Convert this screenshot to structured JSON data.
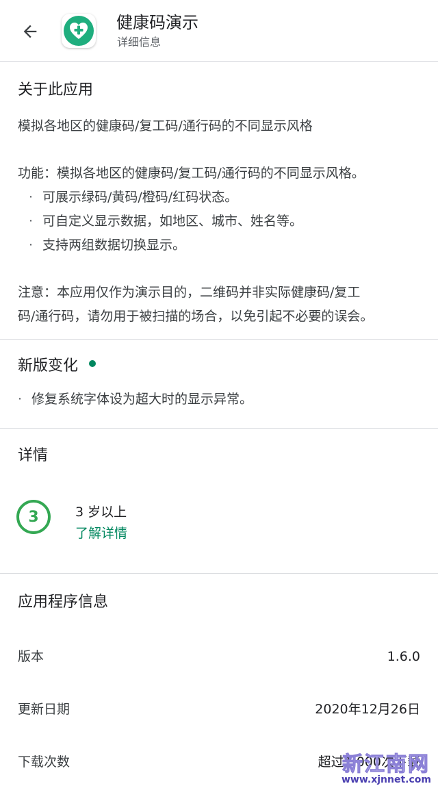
{
  "header": {
    "back_icon": "arrow-back-icon",
    "app_icon": "health-shield-plus-icon",
    "title": "健康码演示",
    "subtitle": "详细信息"
  },
  "about": {
    "title": "关于此应用",
    "summary": "模拟各地区的健康码/复工码/通行码的不同显示风格",
    "features_intro": "功能：模拟各地区的健康码/复工码/通行码的不同显示风格。",
    "bullets": [
      "可展示绿码/黄码/橙码/红码状态。",
      "可自定义显示数据，如地区、城市、姓名等。",
      "支持两组数据切换显示。"
    ],
    "notice_line1": "注意：本应用仅作为演示目的，二维码并非实际健康码/复工",
    "notice_line2": "码/通行码，请勿用于被扫描的场合，以免引起不必要的误会。"
  },
  "whats_new": {
    "title": "新版变化",
    "item": "修复系统字体设为超大时的显示异常。"
  },
  "details": {
    "title": "详情",
    "rating_number": "3",
    "rating_label": "3 岁以上",
    "rating_link": "了解详情"
  },
  "app_info": {
    "title": "应用程序信息",
    "rows": [
      {
        "label": "版本",
        "value": "1.6.0"
      },
      {
        "label": "更新日期",
        "value": "2020年12月26日"
      },
      {
        "label": "下载次数",
        "value": "超过1,000次下载"
      }
    ]
  },
  "watermark": {
    "top": "新江南网",
    "bottom": "www.xjnnet.com"
  },
  "colors": {
    "accent": "#01875f",
    "rating_green": "#34a853",
    "divider": "#dadce0"
  }
}
